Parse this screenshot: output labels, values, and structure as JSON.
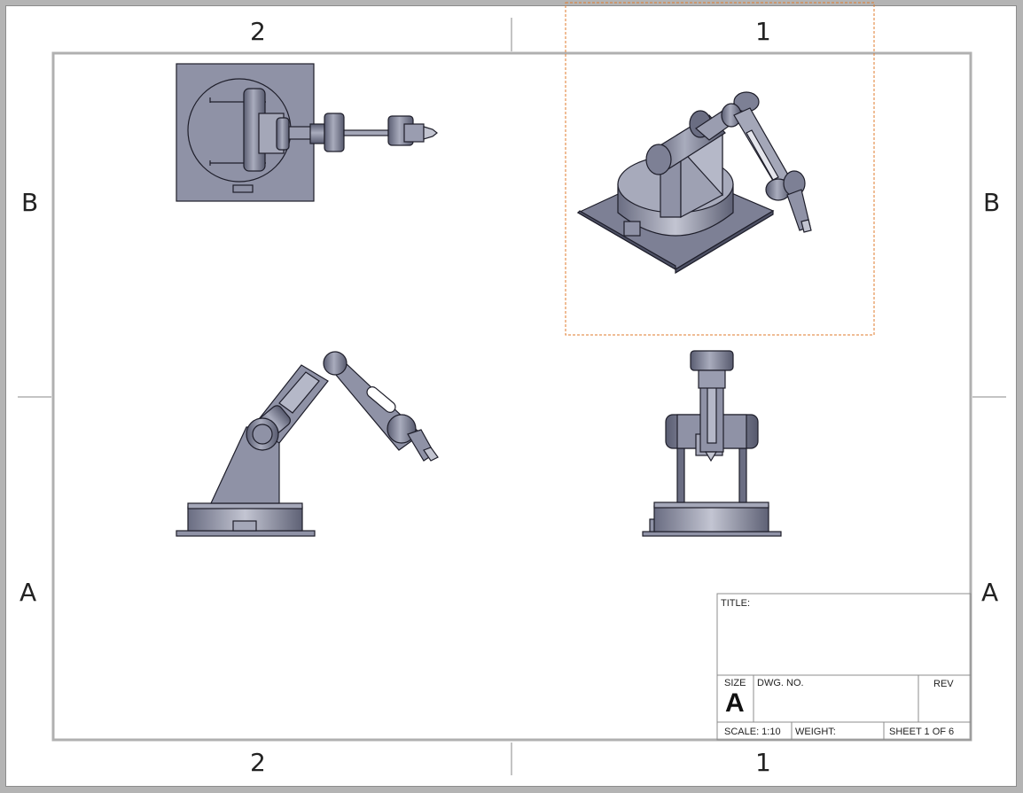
{
  "sheet": {
    "zones": {
      "top_columns": [
        "2",
        "1"
      ],
      "bottom_columns": [
        "2",
        "1"
      ],
      "left_rows": [
        "B",
        "A"
      ],
      "right_rows": [
        "B",
        "A"
      ]
    },
    "views": [
      "top-view",
      "isometric-view",
      "front-view",
      "side-view"
    ]
  },
  "title_block": {
    "title_label": "TITLE:",
    "size_label": "SIZE",
    "size_value": "A",
    "dwg_no_label": "DWG. NO.",
    "rev_label": "REV",
    "scale_text": "SCALE: 1:10",
    "weight_label": "WEIGHT:",
    "sheet_text": "SHEET 1 OF 6"
  },
  "colors": {
    "part_fill": "#8f92a6",
    "part_dark": "#4d5064",
    "part_light": "#b3b6c6",
    "outline": "#1e1e2a",
    "border": "#b0b0b0",
    "selection": "#e07b2e"
  }
}
